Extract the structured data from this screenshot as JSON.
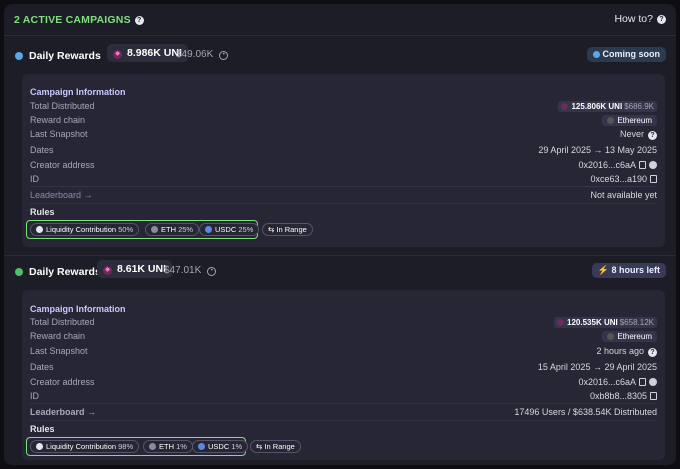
{
  "header": {
    "active_count": "2 ACTIVE CAMPAIGNS",
    "how_to": "How to?"
  },
  "colors": {
    "accent_green": "#7ee07a",
    "link_purple": "#a0a4ff",
    "upcoming_blue": "#5aa8e8",
    "live_green": "#4fbf6a"
  },
  "campaigns": [
    {
      "title": "Daily Rewards",
      "reward": "8.986K UNI",
      "reward_usd": "$49.06K",
      "status": "Coming soon",
      "info_title": "Campaign Information",
      "labels": {
        "total": "Total Distributed",
        "chain": "Reward chain",
        "snapshot": "Last Snapshot",
        "dates": "Dates",
        "creator": "Creator address",
        "id": "ID",
        "leaderboard": "Leaderboard →",
        "rules": "Rules"
      },
      "total_distributed": "125.806K UNI",
      "total_distributed_usd": "$686.9K",
      "reward_chain": "Ethereum",
      "last_snapshot": "Never",
      "dates": "29 April 2025 → 13 May 2025",
      "creator_address": "0x2016...c6aA",
      "campaign_id": "0xce63...a190",
      "leaderboard_value": "Not available yet",
      "rules": [
        {
          "label": "Liquidity Contribution",
          "pct": "50%"
        },
        {
          "label": "ETH",
          "pct": "25%"
        },
        {
          "label": "USDC",
          "pct": "25%"
        }
      ],
      "in_range": "In Range"
    },
    {
      "title": "Daily Rewards",
      "reward": "8.61K UNI",
      "reward_usd": "$47.01K",
      "status": "8 hours left",
      "info_title": "Campaign Information",
      "labels": {
        "total": "Total Distributed",
        "chain": "Reward chain",
        "snapshot": "Last Snapshot",
        "dates": "Dates",
        "creator": "Creator address",
        "id": "ID",
        "leaderboard": "Leaderboard →",
        "rules": "Rules"
      },
      "total_distributed": "120.535K UNI",
      "total_distributed_usd": "$658.12K",
      "reward_chain": "Ethereum",
      "last_snapshot": "2 hours ago",
      "dates": "15 April 2025 → 29 April 2025",
      "creator_address": "0x2016...c6aA",
      "campaign_id": "0xb8b8...8305",
      "leaderboard_value": "17496 Users / $638.54K Distributed",
      "rules": [
        {
          "label": "Liquidity Contribution",
          "pct": "98%"
        },
        {
          "label": "ETH",
          "pct": "1%"
        },
        {
          "label": "USDC",
          "pct": "1%"
        }
      ],
      "in_range": "In Range"
    }
  ]
}
